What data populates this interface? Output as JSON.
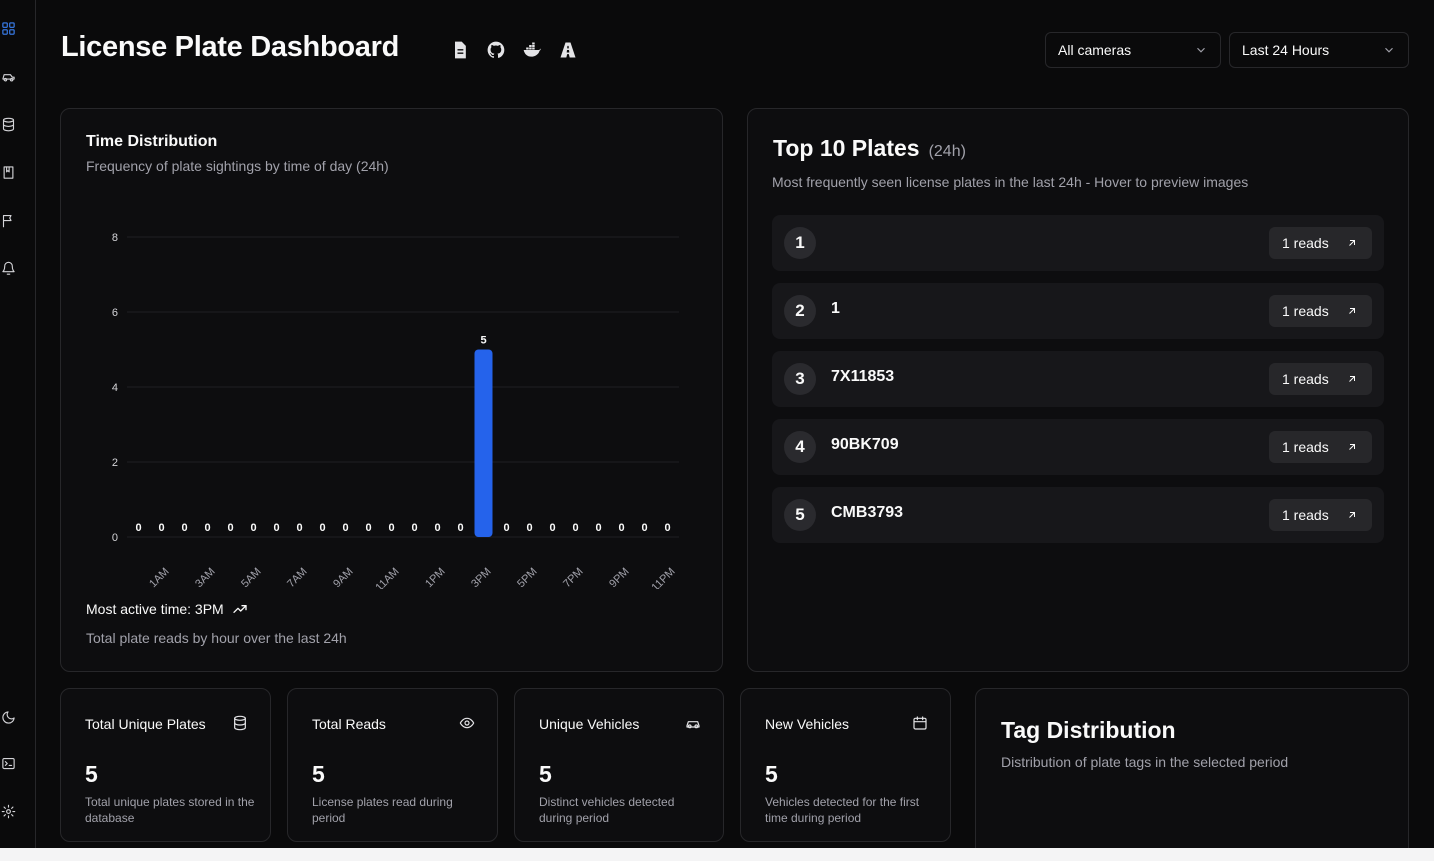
{
  "header": {
    "title": "License Plate Dashboard",
    "icons": [
      "document-icon",
      "github-icon",
      "docker-icon",
      "road-icon"
    ],
    "camera_select": "All cameras",
    "period_select": "Last 24 Hours"
  },
  "sidebar": {
    "top_icons": [
      "dashboard-icon",
      "car-icon",
      "database-icon",
      "book-icon",
      "flag-icon",
      "bell-icon"
    ],
    "bottom_icons": [
      "moon-icon",
      "terminal-icon",
      "gear-icon"
    ],
    "active_color": "#3b82f6"
  },
  "time_distribution": {
    "title": "Time Distribution",
    "subtitle": "Frequency of plate sightings by time of day (24h)",
    "most_active": "Most active time: 3PM",
    "footer": "Total plate reads by hour over the last 24h"
  },
  "chart_data": {
    "type": "bar",
    "categories": [
      "12AM",
      "1AM",
      "2AM",
      "3AM",
      "4AM",
      "5AM",
      "6AM",
      "7AM",
      "8AM",
      "9AM",
      "10AM",
      "11AM",
      "12PM",
      "1PM",
      "2PM",
      "3PM",
      "4PM",
      "5PM",
      "6PM",
      "7PM",
      "8PM",
      "9PM",
      "10PM",
      "11PM"
    ],
    "tick_labels_shown": [
      "1AM",
      "3AM",
      "5AM",
      "7AM",
      "9AM",
      "11AM",
      "1PM",
      "3PM",
      "5PM",
      "7PM",
      "9PM",
      "11PM"
    ],
    "values": [
      0,
      0,
      0,
      0,
      0,
      0,
      0,
      0,
      0,
      0,
      0,
      0,
      0,
      0,
      0,
      5,
      0,
      0,
      0,
      0,
      0,
      0,
      0,
      0
    ],
    "yticks": [
      0,
      2,
      4,
      6,
      8
    ],
    "ylim": [
      0,
      8
    ],
    "bar_color": "#2563eb",
    "grid": true
  },
  "top_plates": {
    "title": "Top 10 Plates",
    "badge": "(24h)",
    "subtitle": "Most frequently seen license plates in the last 24h - Hover to preview images",
    "rows": [
      {
        "rank": "1",
        "plate": "",
        "reads": "1 reads"
      },
      {
        "rank": "2",
        "plate": "1",
        "reads": "1 reads"
      },
      {
        "rank": "3",
        "plate": "7X11853",
        "reads": "1 reads"
      },
      {
        "rank": "4",
        "plate": "90BK709",
        "reads": "1 reads"
      },
      {
        "rank": "5",
        "plate": "CMB3793",
        "reads": "1 reads"
      }
    ]
  },
  "stats": [
    {
      "title": "Total Unique Plates",
      "value": "5",
      "desc": "Total unique plates stored in the database",
      "icon": "database-icon"
    },
    {
      "title": "Total Reads",
      "value": "5",
      "desc": "License plates read during period",
      "icon": "eye-icon"
    },
    {
      "title": "Unique Vehicles",
      "value": "5",
      "desc": "Distinct vehicles detected during period",
      "icon": "car-icon"
    },
    {
      "title": "New Vehicles",
      "value": "5",
      "desc": "Vehicles detected for the first time during period",
      "icon": "calendar-icon"
    }
  ],
  "tag_distribution": {
    "title": "Tag Distribution",
    "subtitle": "Distribution of plate tags in the selected period"
  }
}
